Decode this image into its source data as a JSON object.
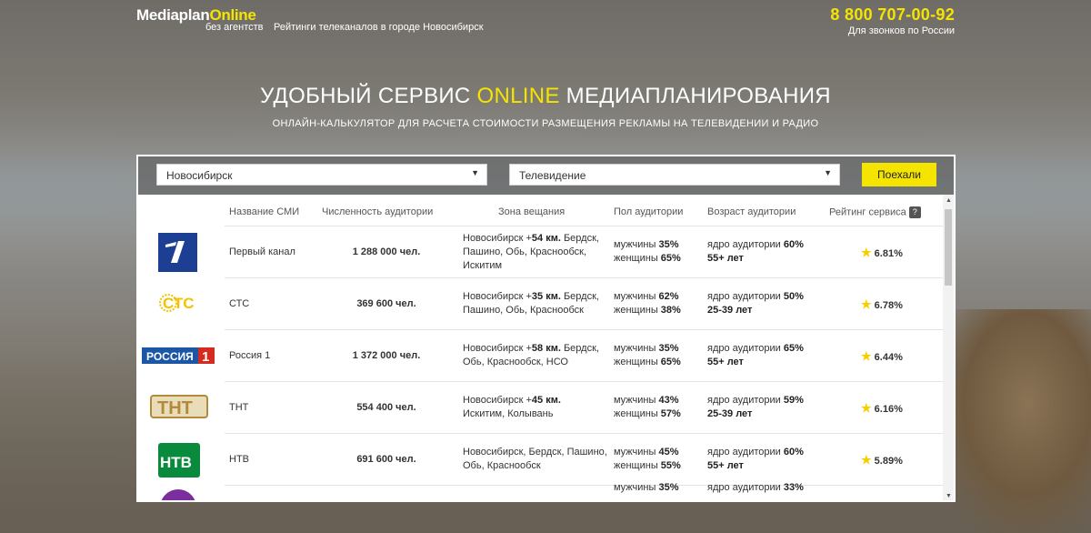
{
  "header": {
    "logo_main": "Mediaplan",
    "logo_accent": "Online",
    "logo_sub": "без агентств",
    "tagline": "Рейтинги телеканалов в городе Новосибирск",
    "phone": "8 800 707-00-92",
    "phone_note": "Для звонков по России"
  },
  "hero": {
    "title_start": "УДОБНЫЙ СЕРВИС ",
    "title_accent": "ONLINE",
    "title_end": " МЕДИАПЛАНИРОВАНИЯ",
    "subtitle": "ОНЛАЙН-КАЛЬКУЛЯТОР ДЛЯ РАСЧЕТА СТОИМОСТИ РАЗМЕЩЕНИЯ РЕКЛАМЫ НА ТЕЛЕВИДЕНИИ И РАДИО"
  },
  "search": {
    "city": "Новосибирск",
    "media": "Телевидение",
    "go_label": "Поехали"
  },
  "table": {
    "columns": {
      "name": "Название СМИ",
      "audience": "Численность аудитории",
      "zone": "Зона вещания",
      "gender": "Пол аудитории",
      "age": "Возраст аудитории",
      "rating": "Рейтинг сервиса",
      "help": "?"
    },
    "rows": [
      {
        "name": "Первый канал",
        "audience": "1 288 000 чел.",
        "zone_a": "Новосибирск +",
        "zone_b": "54 км.",
        "zone_c": " Бердск, Пашино, Обь, Краснообск, Искитим",
        "male": "35%",
        "female": "65%",
        "core": "60%",
        "age": "55+ лет",
        "rating": "6.81%"
      },
      {
        "name": "СТС",
        "audience": "369 600 чел.",
        "zone_a": "Новосибирск +",
        "zone_b": "35 км.",
        "zone_c": " Бердск, Пашино, Обь, Краснообск",
        "male": "62%",
        "female": "38%",
        "core": "50%",
        "age": "25-39 лет",
        "rating": "6.78%"
      },
      {
        "name": "Россия 1",
        "audience": "1 372 000 чел.",
        "zone_a": "Новосибирск +",
        "zone_b": "58 км.",
        "zone_c": " Бердск, Обь, Краснообск, НСО",
        "male": "35%",
        "female": "65%",
        "core": "65%",
        "age": "55+ лет",
        "rating": "6.44%"
      },
      {
        "name": "ТНТ",
        "audience": "554 400 чел.",
        "zone_a": "Новосибирск +",
        "zone_b": "45 км.",
        "zone_c": " Искитим, Колывань",
        "male": "43%",
        "female": "57%",
        "core": "59%",
        "age": "25-39 лет",
        "rating": "6.16%"
      },
      {
        "name": "НТВ",
        "audience": "691 600 чел.",
        "zone_a": "Новосибирск, Бердск, Пашино, Обь, Краснообск",
        "zone_b": "",
        "zone_c": "",
        "male": "45%",
        "female": "55%",
        "core": "60%",
        "age": "55+ лет",
        "rating": "5.89%"
      },
      {
        "name": "",
        "audience": "",
        "zone_a": "",
        "zone_b": "",
        "zone_c": "",
        "male": "35%",
        "female": "",
        "core": "33%",
        "age": "",
        "rating": ""
      }
    ],
    "labels": {
      "male": "мужчины ",
      "female": "женщины ",
      "core": "ядро аудитории "
    },
    "logos": {
      "russia": "РОССИЯ",
      "russia_num": "1",
      "sts": "СТС",
      "tnt": "ТНТ",
      "ntv": "НТВ"
    }
  },
  "colors": {
    "accent": "#f5e400",
    "channel1_blue": "#1c3f94",
    "russia_blue": "#1c57a5",
    "russia_red": "#d52b1e",
    "ntv_green": "#0a8a3c",
    "sts_yellow": "#f3c200",
    "tnt_brown": "#b38a3a",
    "channel_purple": "#7b2e9e"
  },
  "icons": [
    "star-icon",
    "help-icon",
    "dropdown-arrow-icon",
    "scroll-up-icon",
    "scroll-down-icon"
  ]
}
